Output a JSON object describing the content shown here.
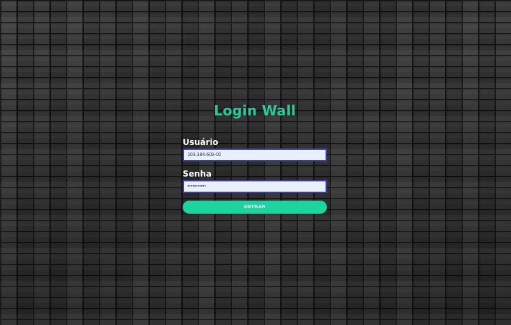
{
  "login": {
    "title": "Login Wall",
    "user_label": "Usuário",
    "user_value": "103.384.609-00",
    "password_label": "Senha",
    "password_value": "•••••••••••",
    "submit_label": "ENTRAR"
  },
  "colors": {
    "accent": "#1dd3a0",
    "title": "#26c99a",
    "field_bg": "#e8f0fe",
    "field_border": "#3b3bb3"
  }
}
